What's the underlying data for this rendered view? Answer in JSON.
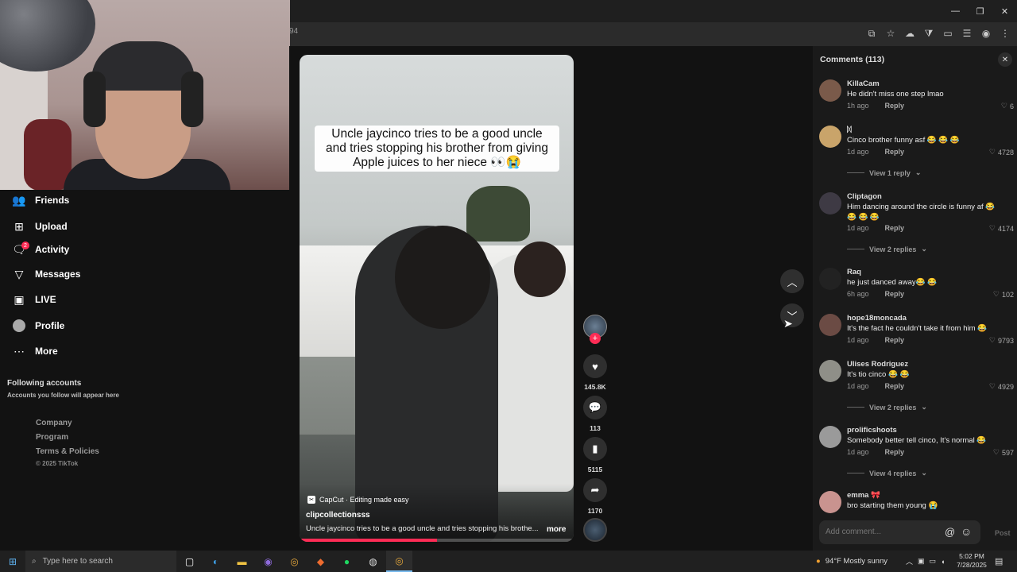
{
  "browser": {
    "address": "94",
    "window_controls": [
      "—",
      "❐",
      "✕"
    ],
    "toolbar_icons": [
      "⧉",
      "☆",
      "☁",
      "⧩",
      "▭",
      "☰",
      "◉",
      "⋮"
    ]
  },
  "sidebar": {
    "nav": [
      {
        "label": "Friends",
        "icon": "friends-icon"
      },
      {
        "label": "Upload",
        "icon": "upload-icon"
      },
      {
        "label": "Activity",
        "icon": "activity-icon",
        "badge": "2"
      },
      {
        "label": "Messages",
        "icon": "messages-icon"
      },
      {
        "label": "LIVE",
        "icon": "live-icon"
      },
      {
        "label": "Profile",
        "icon": "profile-icon"
      },
      {
        "label": "More",
        "icon": "more-icon"
      }
    ],
    "following_title": "Following accounts",
    "following_sub": "Accounts you follow will appear here",
    "footer": [
      "Company",
      "Program",
      "Terms & Policies"
    ],
    "copyright": "© 2025 TikTok"
  },
  "video": {
    "caption_lines": [
      "Uncle jaycinco tries to be a good uncle",
      "and tries stopping his brother from giving",
      "Apple juices to her niece 👀😭"
    ],
    "capcut": "CapCut · Editing made easy",
    "author": "clipcollectionsss",
    "description": "Uncle jaycinco tries to be a good uncle and tries stopping his brothe...",
    "more": "more",
    "progress": 0.5
  },
  "actions": {
    "likes": "145.8K",
    "comments": "113",
    "saves": "5115",
    "shares": "1170"
  },
  "comments": {
    "header": "Comments (113)",
    "items": [
      {
        "user": "KillaCam",
        "text": "He didn't miss one step lmao",
        "time": "1h ago",
        "likes": "6",
        "avatar_color": "#7a5a4a"
      },
      {
        "user": "ᛞ",
        "text": "Cinco brother funny asf 😂 😂 😂",
        "time": "1d ago",
        "likes": "4728",
        "avatar_color": "#c9a46a",
        "view": "View 1 reply"
      },
      {
        "user": "Cliptagon",
        "text": "Him dancing around the circle is funny af 😂 😂 😂 😂",
        "time": "1d ago",
        "likes": "4174",
        "avatar_color": "#3e3a44",
        "view": "View 2 replies"
      },
      {
        "user": "Raq",
        "text": "he just danced away😂 😂",
        "time": "6h ago",
        "likes": "102",
        "avatar_color": "#222222"
      },
      {
        "user": "hope18moncada",
        "text": "It's the fact he couldn't take it from him 😂",
        "time": "1d ago",
        "likes": "9793",
        "avatar_color": "#6b4b44"
      },
      {
        "user": "Ulises Rodriguez",
        "text": "It's tio cinco 😂 😂",
        "time": "1d ago",
        "likes": "4929",
        "avatar_color": "#8f8f88",
        "view": "View 2 replies"
      },
      {
        "user": "prolificshoots",
        "text": "Somebody better tell cinco, It's normal 😂",
        "time": "1d ago",
        "likes": "597",
        "avatar_color": "#9a9a9a",
        "view": "View 4 replies"
      },
      {
        "user": "emma 🎀",
        "text": "bro starting them young 😭",
        "time": "",
        "likes": "",
        "avatar_color": "#c9938f"
      }
    ],
    "reply_label": "Reply",
    "input_placeholder": "Add comment...",
    "post": "Post"
  },
  "taskbar": {
    "search_placeholder": "Type here to search",
    "weather": "94°F  Mostly sunny",
    "time": "5:02 PM",
    "date": "7/28/2025"
  }
}
